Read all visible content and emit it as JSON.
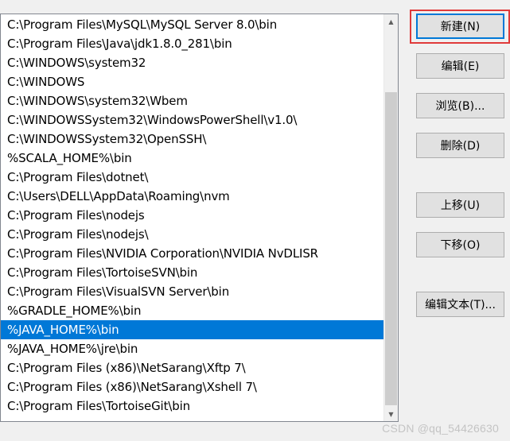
{
  "path_list": {
    "items": [
      "C:\\Program Files\\MySQL\\MySQL Server 8.0\\bin",
      "C:\\Program Files\\Java\\jdk1.8.0_281\\bin",
      "C:\\WINDOWS\\system32",
      "C:\\WINDOWS",
      "C:\\WINDOWS\\system32\\Wbem",
      "C:\\WINDOWSSystem32\\WindowsPowerShell\\v1.0\\",
      "C:\\WINDOWSSystem32\\OpenSSH\\",
      "%SCALA_HOME%\\bin",
      "C:\\Program Files\\dotnet\\",
      "C:\\Users\\DELL\\AppData\\Roaming\\nvm",
      "C:\\Program Files\\nodejs",
      "C:\\Program Files\\nodejs\\",
      "C:\\Program Files\\NVIDIA Corporation\\NVIDIA NvDLISR",
      "C:\\Program Files\\TortoiseSVN\\bin",
      "C:\\Program Files\\VisualSVN Server\\bin",
      "%GRADLE_HOME%\\bin",
      "%JAVA_HOME%\\bin",
      "%JAVA_HOME%\\jre\\bin",
      "C:\\Program Files (x86)\\NetSarang\\Xftp 7\\",
      "C:\\Program Files (x86)\\NetSarang\\Xshell 7\\",
      "C:\\Program Files\\TortoiseGit\\bin"
    ],
    "selected_index": 16
  },
  "buttons": {
    "new": "新建(N)",
    "edit": "编辑(E)",
    "browse": "浏览(B)...",
    "delete": "删除(D)",
    "move_up": "上移(U)",
    "move_down": "下移(O)",
    "edit_text": "编辑文本(T)..."
  },
  "scrollbar": {
    "up_arrow_icon": "▲",
    "down_arrow_icon": "▼"
  },
  "watermark": "CSDN @qq_54426630",
  "colors": {
    "selection": "#0078d7",
    "highlight_box": "#e03a3a"
  }
}
